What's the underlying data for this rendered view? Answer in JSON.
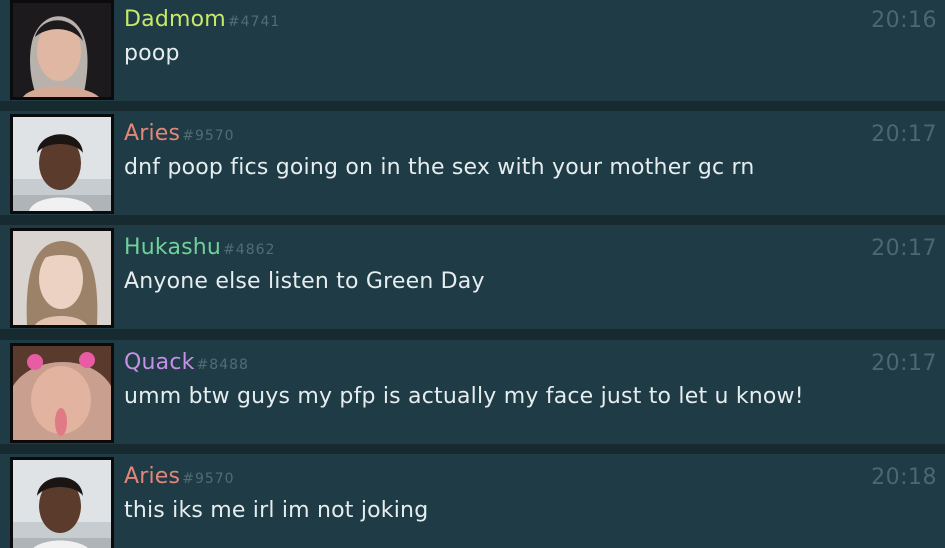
{
  "messages": [
    {
      "username": "Dadmom",
      "tag": "#4741",
      "time": "20:16",
      "text": "poop",
      "name_color": "#c8e86a",
      "avatar_icon": "user-photo-avatar"
    },
    {
      "username": "Aries",
      "tag": "#9570",
      "time": "20:17",
      "text": "dnf poop fics going on in the sex with your mother gc rn",
      "name_color": "#e3877a",
      "avatar_icon": "user-photo-avatar"
    },
    {
      "username": "Hukashu",
      "tag": "#4862",
      "time": "20:17",
      "text": "Anyone else listen to Green Day",
      "name_color": "#6fd29a",
      "avatar_icon": "user-photo-avatar"
    },
    {
      "username": "Quack",
      "tag": "#8488",
      "time": "20:17",
      "text": "umm btw guys my pfp is actually my face just to let u know!",
      "name_color": "#c98ee6",
      "avatar_icon": "user-photo-avatar"
    },
    {
      "username": "Aries",
      "tag": "#9570",
      "time": "20:18",
      "text": "this iks me irl im not joking",
      "name_color": "#e3877a",
      "avatar_icon": "user-photo-avatar"
    }
  ]
}
